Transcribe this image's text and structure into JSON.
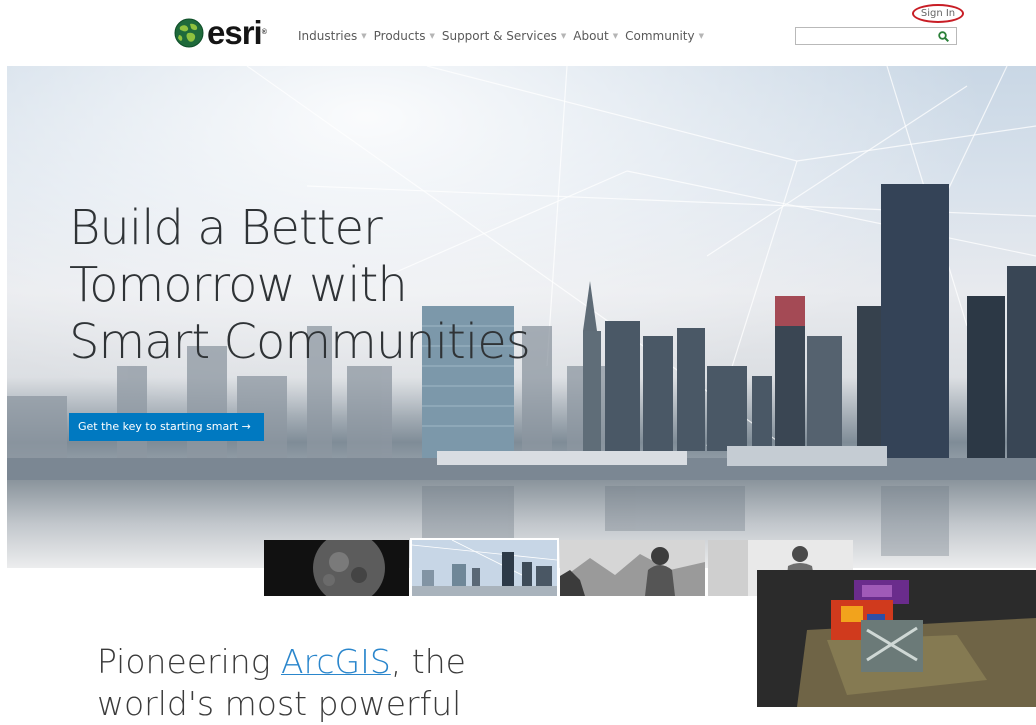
{
  "header": {
    "logo_text": "esri",
    "logo_mark": "®",
    "logo_icon": "globe-icon",
    "signin_label": "Sign In",
    "search": {
      "value": "",
      "icon": "search-icon"
    },
    "nav": [
      {
        "label": "Industries",
        "icon": "chevron-down-icon"
      },
      {
        "label": "Products",
        "icon": "chevron-down-icon"
      },
      {
        "label": "Support & Services",
        "icon": "chevron-down-icon"
      },
      {
        "label": "About",
        "icon": "chevron-down-icon"
      },
      {
        "label": "Community",
        "icon": "chevron-down-icon"
      }
    ]
  },
  "hero": {
    "title_lines": [
      "Build a Better",
      "Tomorrow with",
      "Smart Communities"
    ],
    "cta_label": "Get the key to starting smart →"
  },
  "carousel": {
    "active_index": 1,
    "thumbnails": [
      "moon-image",
      "city-skyline-image",
      "hiker-image",
      "woman-at-laptop-image"
    ]
  },
  "section": {
    "heading_prefix": "Pioneering ",
    "heading_link": "ArcGIS",
    "heading_suffix": ", the",
    "heading_line2": "world's most powerful"
  },
  "colors": {
    "accent_blue": "#0079c1",
    "link_blue": "#2a86cc",
    "signin_highlight": "#c81d25",
    "search_icon_green": "#2a7f38"
  }
}
